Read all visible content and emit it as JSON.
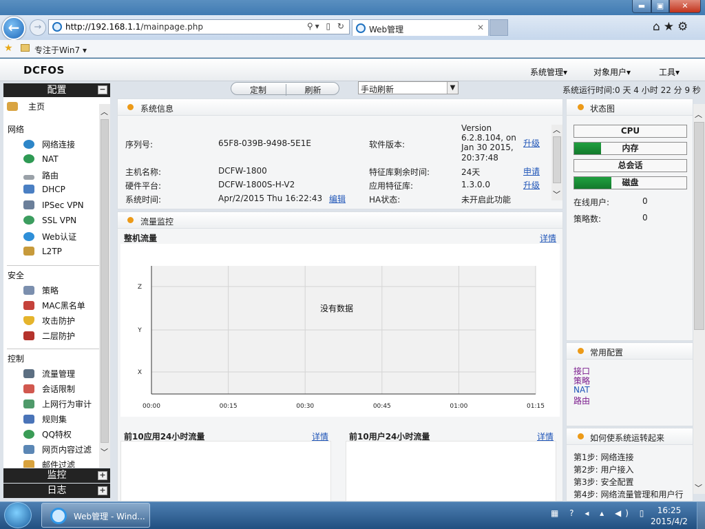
{
  "browser": {
    "url_host": "http://192.168.1.1",
    "url_path": "/mainpage.php",
    "tab_title": "Web管理",
    "favorite_label": "专注于Win7",
    "window_buttons": {
      "minimize": "▬",
      "maximize": "▣",
      "close": "✕"
    }
  },
  "header": {
    "logo": "DCFOS",
    "menu": {
      "system": "系统管理▾",
      "objects": "对象用户▾",
      "tools": "工具▾"
    }
  },
  "toolbar": {
    "custom": "定制",
    "refresh": "刷新",
    "refresh_mode": "手动刷新",
    "uptime": "系统运行时间:0 天 4 小时 22 分 9 秒"
  },
  "sidebar": {
    "title": "配置",
    "home": "主页",
    "groups": {
      "network": {
        "label": "网络",
        "items": [
          "网络连接",
          "NAT",
          "路由",
          "DHCP",
          "IPSec VPN",
          "SSL VPN",
          "Web认证",
          "L2TP"
        ]
      },
      "security": {
        "label": "安全",
        "items": [
          "策略",
          "MAC黑名单",
          "攻击防护",
          "二层防护"
        ]
      },
      "control": {
        "label": "控制",
        "items": [
          "流量管理",
          "会话限制",
          "上网行为审计",
          "规则集",
          "QQ特权",
          "网页内容过滤",
          "邮件过滤"
        ]
      }
    },
    "monitor": "监控",
    "log": "日志"
  },
  "sysinfo": {
    "title": "系统信息",
    "serial_label": "序列号:",
    "serial": "65F8-039B-9498-5E1E",
    "hostname_label": "主机名称:",
    "hostname": "DCFW-1800",
    "platform_label": "硬件平台:",
    "platform": "DCFW-1800S-H-V2",
    "time_label": "系统时间:",
    "time": "Apr/2/2015 Thu 16:22:43",
    "edit": "编辑",
    "sw_label": "软件版本:",
    "sw_line1": "Version",
    "sw_line2": "6.2.8.104, on",
    "sw_line3": "Jan 30 2015,",
    "sw_line4": "20:37:48",
    "upgrade": "升级",
    "sig_left_label": "特征库剩余时间:",
    "sig_left": "24天",
    "apply": "申请",
    "app_sig_label": "应用特征库:",
    "app_sig": "1.3.0.0",
    "ha_label": "HA状态:",
    "ha": "未开启此功能"
  },
  "flow": {
    "title": "流量监控",
    "whole_title": "整机流量",
    "detail": "详情",
    "no_data": "没有数据",
    "top_apps_title": "前10应用24小时流量",
    "top_users_title": "前10用户24小时流量"
  },
  "chart_data": {
    "type": "line",
    "title": "整机流量",
    "x": [
      "00:00",
      "00:15",
      "00:30",
      "00:45",
      "01:00",
      "01:15"
    ],
    "y_ticks": [
      "X",
      "Y",
      "Z"
    ],
    "series": [],
    "grid": true,
    "annotation": "没有数据"
  },
  "status": {
    "title": "状态图",
    "cpu_label": "CPU",
    "cpu_level": 0,
    "mem_label": "内存",
    "mem_level": 0.24,
    "sess_label": "总会话",
    "sess_level": 0,
    "disk_label": "磁盘",
    "disk_level": 0.33,
    "online_label": "在线用户:",
    "online": "0",
    "policy_label": "策略数:",
    "policy": "0"
  },
  "common": {
    "title": "常用配置",
    "links": [
      "接口",
      "策略",
      "NAT",
      "路由"
    ]
  },
  "howto": {
    "title": "如何使系统运转起来",
    "steps": [
      "第1步: 网络连接",
      "第2步: 用户接入",
      "第3步: 安全配置",
      "第4步: 网络流量管理和用户行"
    ]
  },
  "taskbar": {
    "task_label": "Web管理 - Wind...",
    "time": "16:25",
    "date": "2015/4/2",
    "tray": "▦ ? ◂ ▴ ◀) ▯"
  }
}
